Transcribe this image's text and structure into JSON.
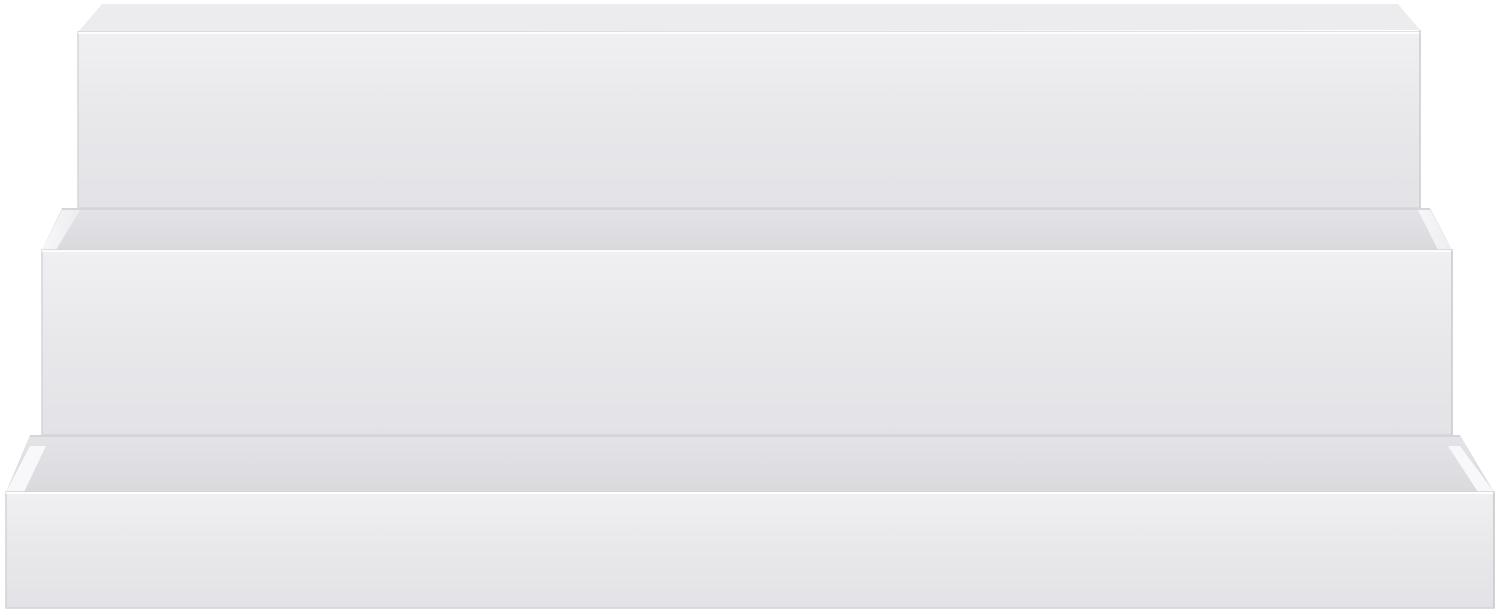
{
  "image": {
    "subject": "three-tier-acrylic-riser",
    "tier_count": 3
  },
  "colors": {
    "background": "#ffffff",
    "front_face": "#e9e9ec",
    "front_face_light": "#f1f1f3",
    "shelf_top": "#dedee2",
    "edge_highlight": "#fbfbfc",
    "edge_shadow": "#c9c9ce"
  }
}
